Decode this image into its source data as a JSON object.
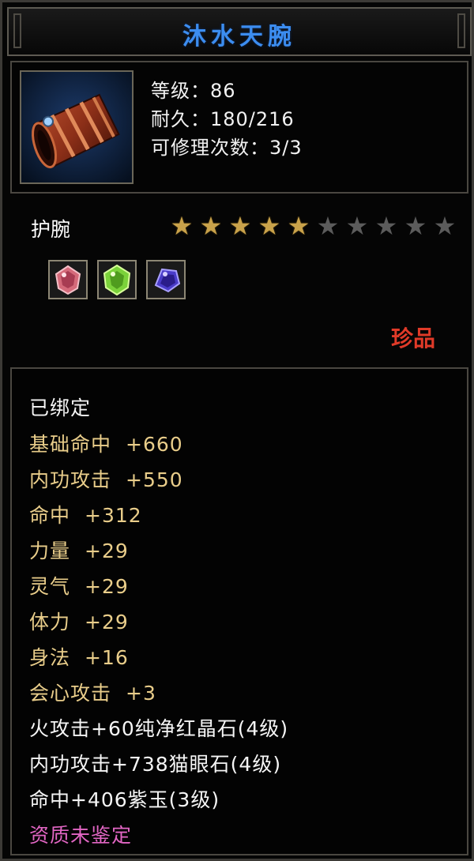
{
  "item": {
    "name": "沐水天腕",
    "level": "等级：86",
    "durability": "耐久：180/216",
    "repair": "可修理次数：3/3",
    "type": "护腕",
    "stars_filled": 5,
    "stars_total": 10,
    "gems": [
      "red-gem-icon",
      "green-gem-icon",
      "purple-gem-icon"
    ],
    "rarity": "珍品"
  },
  "props": {
    "bound": "已绑定",
    "stats": [
      {
        "name": "基础命中",
        "value": "+660"
      },
      {
        "name": "内功攻击",
        "value": "+550"
      },
      {
        "name": "命中",
        "value": "+312"
      },
      {
        "name": "力量",
        "value": "+29"
      },
      {
        "name": "灵气",
        "value": "+29"
      },
      {
        "name": "体力",
        "value": "+29"
      },
      {
        "name": "身法",
        "value": "+16"
      },
      {
        "name": "会心攻击",
        "value": "+3"
      }
    ],
    "gem_bonus": [
      "火攻击+60纯净红晶石(4级)",
      "内功攻击+738猫眼石(4级)",
      "命中+406紫玉(3级)"
    ],
    "quality": "资质未鉴定"
  },
  "colors": {
    "title": "#3c8df0",
    "stat_name_gold": "#e9cd8a",
    "rarity_red": "#e03a28",
    "quality_pink": "#e266c4"
  }
}
